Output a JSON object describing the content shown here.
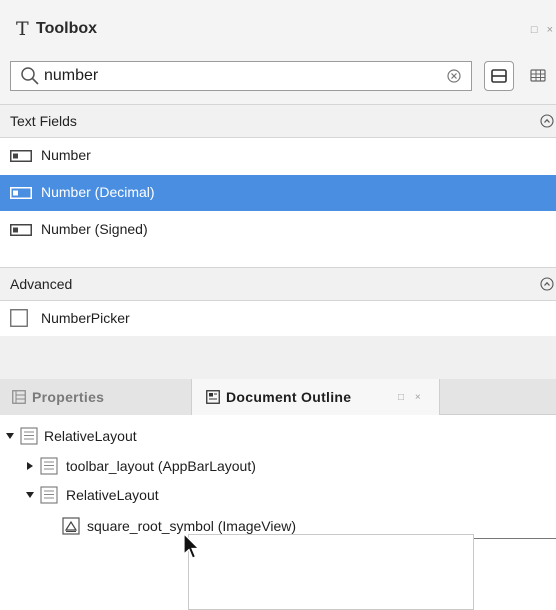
{
  "toolbox": {
    "title": "Toolbox",
    "title_glyph": "T",
    "window_buttons": "□ ×",
    "search": {
      "value": "number",
      "placeholder": ""
    }
  },
  "groups": [
    {
      "label": "Text Fields",
      "items": [
        {
          "label": "Number",
          "icon": "text-field-icon",
          "selected": false
        },
        {
          "label": "Number (Decimal)",
          "icon": "text-field-icon",
          "selected": true
        },
        {
          "label": "Number (Signed)",
          "icon": "text-field-icon",
          "selected": false
        }
      ]
    },
    {
      "label": "Advanced",
      "items": [
        {
          "label": "NumberPicker",
          "icon": "checkbox-icon",
          "selected": false
        }
      ]
    }
  ],
  "tabs": [
    {
      "label": "Properties",
      "active": false
    },
    {
      "label": "Document Outline",
      "active": true,
      "controls": "□ ×"
    }
  ],
  "outline": [
    {
      "label": "RelativeLayout",
      "expanded": true
    },
    {
      "label": "toolbar_layout (AppBarLayout)",
      "expanded": false
    },
    {
      "label": "RelativeLayout",
      "expanded": true
    },
    {
      "label": "square_root_symbol (ImageView)"
    }
  ],
  "colors": {
    "selection": "#4a8ee2",
    "panel_bg": "#f4f4f4",
    "tab_bar_bg": "#e4e4e4"
  }
}
